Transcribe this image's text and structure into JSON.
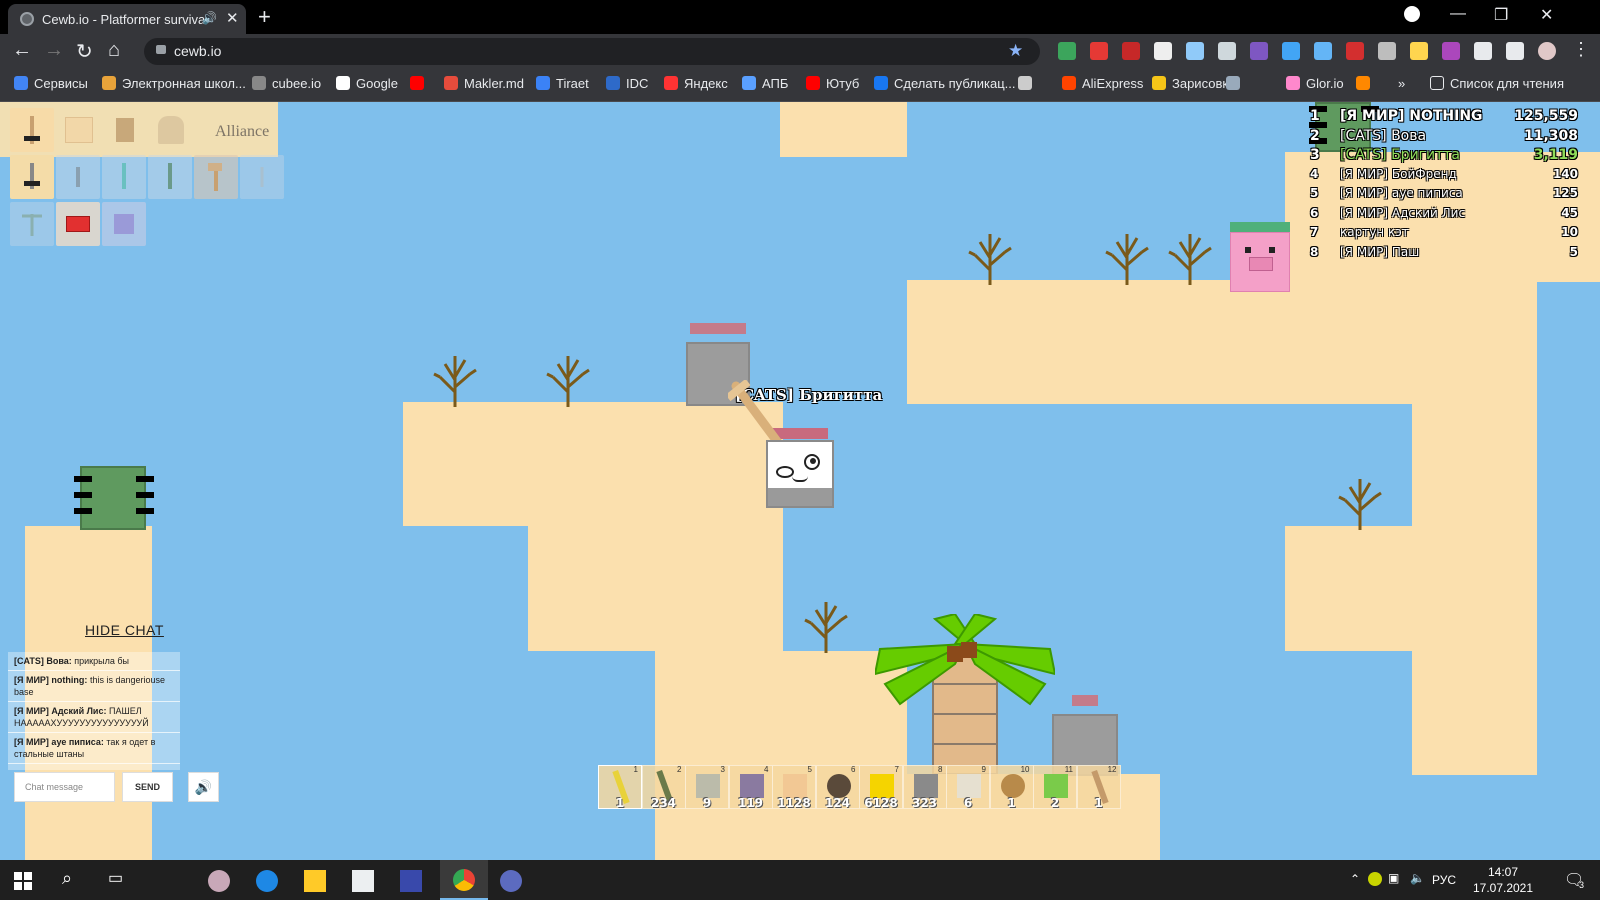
{
  "browser": {
    "tab_title": "Cewb.io - Platformer survival",
    "url": "cewb.io",
    "new_tab_symbol": "+",
    "bookmarks": [
      {
        "label": "Сервисы",
        "color": "#4285f4"
      },
      {
        "label": "Электронная школ...",
        "color": "#e8a33a"
      },
      {
        "label": "cubee.io",
        "color": "#888888"
      },
      {
        "label": "Google",
        "color": "#ffffff"
      },
      {
        "label": "",
        "color": "#ff0000"
      },
      {
        "label": "Makler.md",
        "color": "#e74c3c"
      },
      {
        "label": "Tiraet",
        "color": "#3b82f6"
      },
      {
        "label": "IDC",
        "color": "#2e6ac9"
      },
      {
        "label": "Яндекс",
        "color": "#ff3333"
      },
      {
        "label": "АПБ",
        "color": "#5aa0ff"
      },
      {
        "label": "Ютуб",
        "color": "#ff0000"
      },
      {
        "label": "Сделать публикац...",
        "color": "#1877f2"
      },
      {
        "label": "",
        "color": "#cccccc"
      },
      {
        "label": "AliExpress",
        "color": "#ff4400"
      },
      {
        "label": "Зарисовка!",
        "color": "#f5c518"
      },
      {
        "label": "",
        "color": "#9ab"
      },
      {
        "label": "Glor.io",
        "color": "#ff88cc"
      },
      {
        "label": "",
        "color": "#ff8800"
      }
    ],
    "overflow_label": "»",
    "reading_list_label": "Список для чтения"
  },
  "game": {
    "alliance_label": "Alliance",
    "player_name": "[CATS] Бригитта",
    "leaderboard": [
      {
        "rank": "1",
        "name": "[Я МИР] NOTHING",
        "score": "125,559",
        "highlight": false
      },
      {
        "rank": "2",
        "name": "[CATS] Вова",
        "score": "11,308",
        "highlight": false
      },
      {
        "rank": "3",
        "name": "[CATS] Бригитта",
        "score": "3,119",
        "highlight": true
      },
      {
        "rank": "4",
        "name": "[Я МИР] БойФренд",
        "score": "140",
        "highlight": false
      },
      {
        "rank": "5",
        "name": "[Я МИР] ауе пиписа",
        "score": "125",
        "highlight": false
      },
      {
        "rank": "6",
        "name": "[Я МИР] Адский Лис",
        "score": "45",
        "highlight": false
      },
      {
        "rank": "7",
        "name": "картун кэт",
        "score": "10",
        "highlight": false
      },
      {
        "rank": "8",
        "name": "[Я МИР] Паш",
        "score": "5",
        "highlight": false
      }
    ],
    "chat": {
      "hide_label": "HIDE CHAT",
      "messages": [
        {
          "author": "[CATS] Вова:",
          "text": "прикрыла бы"
        },
        {
          "author": "[Я МИР] nothing:",
          "text": "this is dangeriouse base"
        },
        {
          "author": "[Я МИР] Адский Лис:",
          "text": "ПАШЕЛ НАААААХУУУУУУУУУУУУУУУЙ"
        },
        {
          "author": "[Я МИР] ауе пиписа:",
          "text": "так я одет в стальные штаны"
        }
      ],
      "input_placeholder": "Chat message",
      "send_label": "SEND",
      "sound_icon": "speaker-icon"
    },
    "hotbar": [
      {
        "num": "1",
        "count": "1",
        "item": "gold-sword",
        "color": "#e8d23a"
      },
      {
        "num": "2",
        "count": "234",
        "item": "stick",
        "color": "#6a7a4a"
      },
      {
        "num": "3",
        "count": "9",
        "item": "stone-block",
        "color": "#bbbbaa"
      },
      {
        "num": "4",
        "count": "119",
        "item": "purple-block",
        "color": "#8a7aa0"
      },
      {
        "num": "5",
        "count": "1128",
        "item": "sand-block",
        "color": "#f2c894"
      },
      {
        "num": "6",
        "count": "124",
        "item": "coal",
        "color": "#5a4a3a"
      },
      {
        "num": "7",
        "count": "6128",
        "item": "gold-block",
        "color": "#f5d400"
      },
      {
        "num": "8",
        "count": "323",
        "item": "stone",
        "color": "#8a8a8a"
      },
      {
        "num": "9",
        "count": "6",
        "item": "white-block",
        "color": "#e6e0d0"
      },
      {
        "num": "10",
        "count": "1",
        "item": "meat",
        "color": "#b88a4a"
      },
      {
        "num": "11",
        "count": "2",
        "item": "green-block",
        "color": "#7acb4a"
      },
      {
        "num": "12",
        "count": "1",
        "item": "wood-pickaxe",
        "color": "#c49a6a"
      }
    ]
  },
  "taskbar": {
    "language": "РУС",
    "time": "14:07",
    "date": "17.07.2021",
    "notification_count": "3"
  }
}
